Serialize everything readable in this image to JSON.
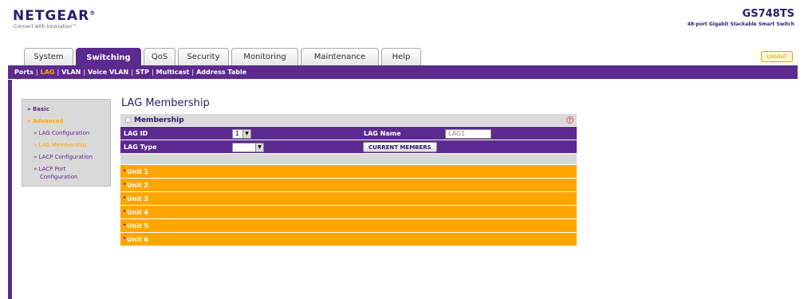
{
  "header": {
    "logo": "NETGEAR",
    "logo_mark": "®",
    "tagline": "Connect with Innovation™",
    "model": "GS748TS",
    "model_desc": "48-port Gigabit Stackable Smart Switch",
    "logout": "LOGOUT"
  },
  "tabs": [
    {
      "label": "System"
    },
    {
      "label": "Switching"
    },
    {
      "label": "QoS"
    },
    {
      "label": "Security"
    },
    {
      "label": "Monitoring"
    },
    {
      "label": "Maintenance"
    },
    {
      "label": "Help"
    }
  ],
  "subnav": [
    "Ports",
    "LAG",
    "VLAN",
    "Voice VLAN",
    "STP",
    "Multicast",
    "Address Table"
  ],
  "subnav_separator": "|",
  "leftmenu": {
    "basic": "» Basic",
    "advanced": "» Advanced",
    "items": [
      "» LAG Configuration",
      "» LAG Membership",
      "» LACP Configuration",
      "» LACP Port",
      "Configuration"
    ]
  },
  "page": {
    "title": "LAG Membership",
    "panel_title": "Membership",
    "help_icon": "?",
    "lag_id_label": "LAG ID",
    "lag_id_value": "1",
    "lag_name_label": "LAG Name",
    "lag_name_value": "LAG1",
    "lag_type_label": "LAG Type",
    "lag_type_value": "",
    "current_members_button": "CURRENT MEMBERS",
    "units": [
      "Unit 1",
      "Unit 2",
      "Unit 3",
      "Unit 4",
      "Unit 5",
      "Unit 6"
    ]
  },
  "colors": {
    "brand_purple": "#5c2a8e",
    "accent_orange": "#ffa500",
    "panel_gray": "#d9d9d9"
  }
}
